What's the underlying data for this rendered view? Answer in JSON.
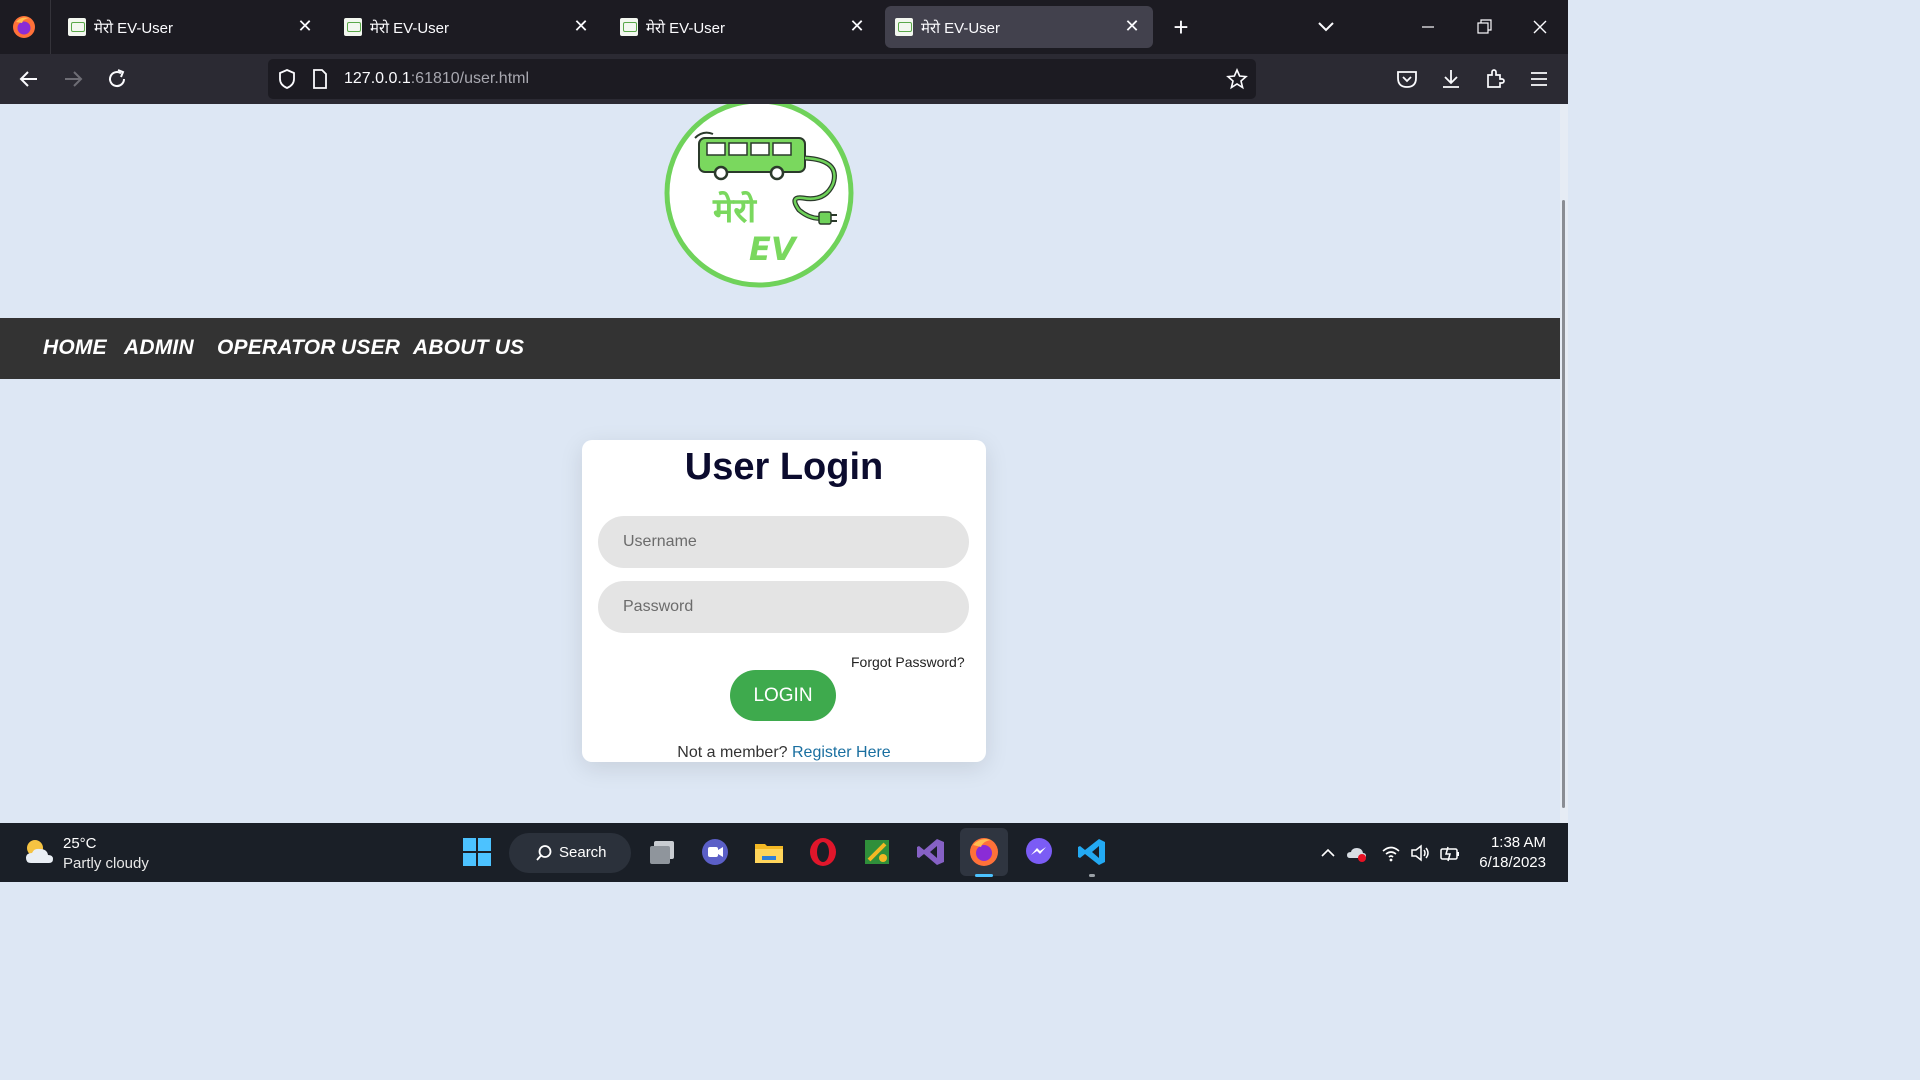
{
  "browser": {
    "tabs": [
      {
        "title": "मेरो EV-User",
        "active": false
      },
      {
        "title": "मेरो EV-User",
        "active": false
      },
      {
        "title": "मेरो EV-User",
        "active": false
      },
      {
        "title": "मेरो EV-User",
        "active": true
      }
    ],
    "url_host": "127.0.0.1",
    "url_rest": ":61810/user.html"
  },
  "site": {
    "logo_text_top": "मेरो",
    "logo_text_bottom": "EV",
    "nav": [
      "HOME",
      "ADMIN",
      "OPERATOR",
      "USER",
      "ABOUT US"
    ]
  },
  "login": {
    "title": "User Login",
    "username_placeholder": "Username",
    "password_placeholder": "Password",
    "forgot": "Forgot Password?",
    "button": "LOGIN",
    "member_text": "Not a member?",
    "register": "Register Here"
  },
  "taskbar": {
    "temperature": "25°C",
    "condition": "Partly cloudy",
    "search_label": "Search",
    "time": "1:38 AM",
    "date": "6/18/2023"
  },
  "colors": {
    "page_bg": "#dde7f4",
    "nav_bg": "#333333",
    "login_button": "#3eaa4d",
    "logo_green": "#6fd25a",
    "register_link": "#1a6fa0"
  }
}
